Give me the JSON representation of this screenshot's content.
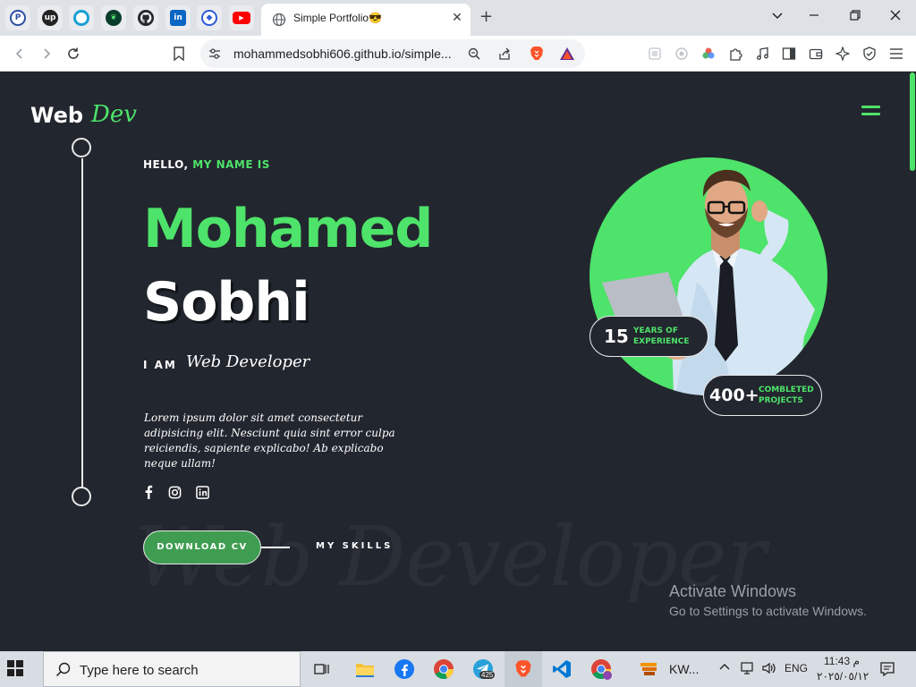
{
  "browser": {
    "pinned_tabs": [
      {
        "name": "paypal-icon",
        "glyph": "P",
        "color": "#2d4ea2"
      },
      {
        "name": "upwork-icon",
        "glyph": "up",
        "color": "#222222"
      },
      {
        "name": "target-icon",
        "glyph": "◎",
        "color": "#1a9fd4"
      },
      {
        "name": "mongodb-icon",
        "glyph": "❦",
        "color": "#0b3d2c"
      },
      {
        "name": "github-icon",
        "glyph": "●",
        "color": "#24292f"
      },
      {
        "name": "linkedin-icon",
        "glyph": "in",
        "color": "#0a66c2"
      },
      {
        "name": "blue-diamond-icon",
        "glyph": "◆",
        "color": "#2e5bd8"
      },
      {
        "name": "youtube-icon",
        "glyph": "▶",
        "color": "#ff0000"
      }
    ],
    "active_tab": {
      "title": "Simple Portfolio😎",
      "close": "✕"
    },
    "new_tab": "+",
    "window_controls": {
      "dropdown": "⌄",
      "minimize": "—",
      "restore": "❐",
      "close": "✕"
    },
    "url": "mohammedsobhi606.github.io/simple..."
  },
  "page": {
    "logo": {
      "main": "Web",
      "script": "Dev"
    },
    "hello": {
      "prefix": "HELLO,",
      "accent": "MY NAME IS"
    },
    "first_name": "Mohamed",
    "last_name": "Sobhi",
    "i_am": "I AM",
    "role": "Web Developer",
    "intro": "Lorem ipsum dolor sit amet consectetur adipisicing elit. Nesciunt quia sint error culpa reiciendis, sapiente explicabo! Ab explicabo neque ullam!",
    "social": [
      {
        "name": "facebook-icon"
      },
      {
        "name": "instagram-icon"
      },
      {
        "name": "linkedin-icon"
      }
    ],
    "download_cv": "DOWNLOAD CV",
    "my_skills": "MY SKILLS",
    "background_text": "Web Developer",
    "badge_years": {
      "number": "15",
      "label_line1": "YEARS OF",
      "label_line2": "EXPERIENCE"
    },
    "badge_projects": {
      "number": "400+",
      "label_line1": "COMBLETED",
      "label_line2": "PROJECTS"
    }
  },
  "watermark": {
    "title": "Activate Windows",
    "subtitle": "Go to Settings to activate Windows."
  },
  "taskbar": {
    "search_placeholder": "Type here to search",
    "telegram_badge": "425",
    "app_label": "KW...",
    "language": "ENG",
    "time": "11:43 م",
    "date": "٢٠٢٥/٠٥/١٢"
  },
  "colors": {
    "accent": "#4ee36a",
    "background": "#22262e",
    "button": "#3f9d51"
  }
}
